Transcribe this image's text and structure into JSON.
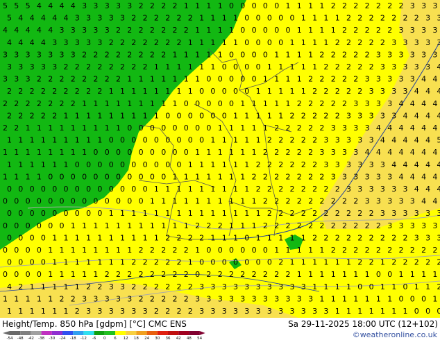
{
  "map": {
    "colors": {
      "cold": "#12b812",
      "cool": "#ffff00",
      "warm": "#f8e050",
      "label": "#000000",
      "border": "#555555",
      "isoline": "#999999",
      "front": "#2040a0"
    },
    "rows": [
      "5 5 5 4 4 4 4 3 3 3 3 3 2 2 2 2 1 1 1 1 0 0 0 0 0 1 1 1 1 2 2 2 2 2 2 2 3 3 3",
      "5 4 4 4 4 4 3 3 3 3 3 2 2 2 2 2 2 1 1 1 1 0 0 0 0 0 1 1 1 1 2 2 2 2 2 2 2 3 3",
      "4 4 4 4 4 3 3 3 3 3 2 2 2 2 2 2 2 1 1 1 1 0 0 0 0 0 1 1 1 1 2 2 2 2 2 3 3 3 3",
      "4 4 4 4 3 3 3 3 3 2 2 2 2 2 2 2 1 1 1 1 1 0 0 0 0 1 1 1 1 2 2 2 2 2 3 3 3 3 3",
      "3 3 3 3 3 3 3 2 2 2 2 2 2 2 2 1 1 1 1 1 0 0 0 0 1 1 1 1 2 2 2 2 2 3 3 3 3 3 3",
      "3 3 3 3 3 2 2 2 2 2 2 2 2 1 1 1 1 1 1 0 0 0 0 1 1 1 1 1 2 2 2 2 2 3 3 3 3 3 4",
      "3 3 3 2 2 2 2 2 2 2 2 1 1 1 1 1 1 1 0 0 0 0 0 1 1 1 1 2 2 2 2 2 3 3 3 3 3 4 4",
      "2 2 2 2 2 2 2 2 2 1 1 1 1 1 1 1 1 0 0 0 0 0 1 1 1 1 1 2 2 2 2 2 3 3 3 3 4 4 4",
      "2 2 2 2 2 2 2 1 1 1 1 1 1 1 1 1 0 0 0 0 0 1 1 1 1 1 2 2 2 2 2 3 3 3 3 4 4 4 4",
      "2 2 2 2 2 1 1 1 1 1 1 1 1 1 0 0 0 0 0 0 1 1 1 1 1 2 2 2 2 2 3 3 3 3 3 4 4 4 4",
      "2 2 1 1 1 1 1 1 1 1 1 0 0 0 0 0 0 0 0 1 1 1 1 1 2 2 2 2 2 3 3 3 3 4 4 4 4 4 4",
      "1 1 1 1 1 1 1 1 1 0 0 0 0 0 0 0 0 0 1 1 1 1 1 2 2 2 2 2 3 3 3 3 3 4 4 4 4 4 5",
      "1 1 1 1 1 1 1 1 0 0 0 0 0 0 0 0 0 1 1 1 1 1 1 2 2 2 2 2 3 3 3 3 4 4 4 4 4 4 4",
      "1 1 1 1 1 1 0 0 0 0 0 0 0 0 0 0 1 1 1 1 1 1 2 2 2 2 2 2 3 3 3 3 3 3 4 4 4 4 4",
      "1 1 1 1 0 0 0 0 0 0 0 0 0 0 0 1 1 1 1 1 1 1 2 2 2 2 2 2 2 3 3 3 3 3 3 4 4 4 4",
      "0 0 0 0 0 0 0 0 0 0 0 0 0 1 1 1 1 1 1 1 1 1 2 2 2 2 2 2 2 2 3 3 3 3 3 3 4 4 4",
      "0 0 0 0 0 0 0 0 0 0 0 0 0 1 1 1 1 1 1 1 1 1 1 2 2 2 2 2 2 2 2 2 3 3 3 3 3 4 4",
      "0 0 0 0 0 0 0 0 0 1 1 1 1 1 1 1 1 1 1 1 1 1 1 2 2 2 2 2 2 2 2 2 2 3 3 3 3 3 3",
      "0 0 0 0 0 0 1 1 1 1 1 1 1 1 1 1 1 2 2 2 1 1 1 2 2 2 2 2 2 2 2 2 2 2 3 3 3 3 3",
      "0 0 0 0 1 1 1 1 1 1 1 1 1 1 2 2 2 2 1 1 1 0 1 1 1 1 1 2 2 2 2 2 2 2 2 2 3 3 3",
      "0 0 0 0 1 1 1 1 1 1 1 1 2 2 2 2 2 1 0 0 0 0 0 0 1 1 1 1 1 2 2 2 2 2 2 2 2 2 2",
      "0 0 0 0 1 1 1 1 1 1 1 2 2 2 2 2 1 0 0 0 0 0 0 0 2 1 1 1 1 1 1 2 2 1 2 2 2 2 2",
      "0 0 0 0 1 1 1 1 1 2 2 2 2 2 2 2 2 0 2 2 2 2 2 2 2 2 1 1 1 1 1 1 1 0 0 1 1 1 1",
      "4 2 1 1 1 1 1 2 2 3 3 2 2 2 2 2 2 3 3 3 3 3 3 3 3 3 3 1 1 1 1 0 0 1 1 0 1 1 2",
      "1 1 1 1 1 2 2 3 3 3 3 3 2 2 2 2 2 3 3 3 3 3 3 3 3 3 3 3 1 1 1 1 1 1 1 0 0 0 1",
      "1 1 1 1 1 1 2 3 3 3 3 3 3 2 2 2 2 3 3 3 3 3 3 3 3 3 3 3 3 1 1 1 1 1 1 1 0 0 0"
    ]
  },
  "footer": {
    "title": "Height/Temp. 850 hPa [gdpm] [°C] CMC ENS",
    "datetime": "Sa 29-11-2025 18:00 UTC (12+102)",
    "credit": "©weatheronline.co.uk",
    "scale": {
      "labels": [
        "-54",
        "-48",
        "-42",
        "-38",
        "-30",
        "-24",
        "-18",
        "-12",
        "-6",
        "0",
        "6",
        "12",
        "18",
        "24",
        "30",
        "36",
        "42",
        "48",
        "54"
      ],
      "colors": [
        "#6a6a6a",
        "#808080",
        "#a0a0a0",
        "#c030c0",
        "#9030d0",
        "#3050f0",
        "#30a0f0",
        "#30e0f0",
        "#10a010",
        "#20c020",
        "#ffff00",
        "#f8d040",
        "#f0a020",
        "#e86010",
        "#e02010",
        "#c01010",
        "#a00020",
        "#800030"
      ]
    }
  }
}
